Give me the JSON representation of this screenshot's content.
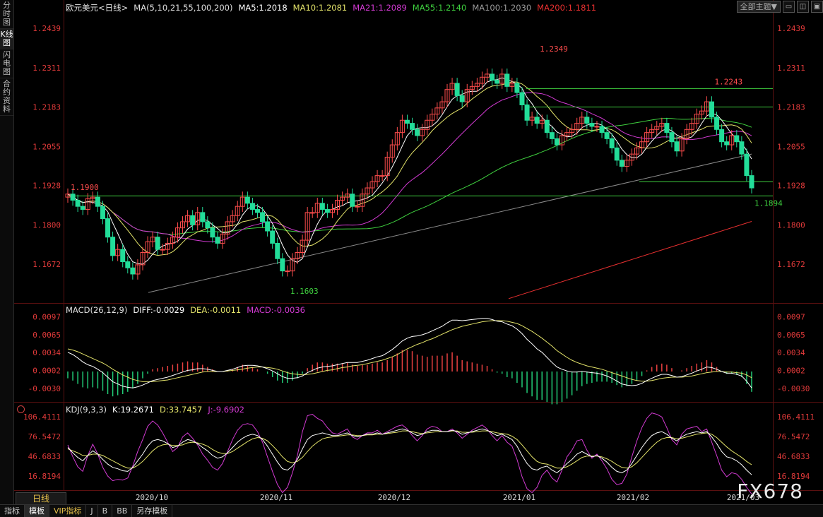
{
  "sidebar": [
    "分时图",
    "K线图",
    "闪电图",
    "合约资料"
  ],
  "topbar": {
    "theme_label": "全部主题▼",
    "buttons": [
      "▭",
      "◫",
      "▣"
    ]
  },
  "main_legend": [
    {
      "text": "欧元美元<日线>",
      "color": "#e0e0e0"
    },
    {
      "text": "MA(5,10,21,55,100,200)",
      "color": "#e0e0e0"
    },
    {
      "text": "MA5:1.2018",
      "color": "#ffffff"
    },
    {
      "text": "MA10:1.2081",
      "color": "#e3e36a"
    },
    {
      "text": "MA21:1.2089",
      "color": "#d23ad2"
    },
    {
      "text": "MA55:1.2140",
      "color": "#3fd13f"
    },
    {
      "text": "MA100:1.2030",
      "color": "#9a9a9a"
    },
    {
      "text": "MA200:1.1811",
      "color": "#e83030"
    }
  ],
  "macd_legend": [
    {
      "text": "MACD(26,12,9)",
      "color": "#e0e0e0"
    },
    {
      "text": "DIFF:-0.0029",
      "color": "#ffffff"
    },
    {
      "text": "DEA:-0.0011",
      "color": "#e3e36a"
    },
    {
      "text": "MACD:-0.0036",
      "color": "#d23ad2"
    }
  ],
  "kdj_legend": [
    {
      "text": "KDJ(9,3,3)",
      "color": "#e0e0e0"
    },
    {
      "text": "K:19.2671",
      "color": "#ffffff"
    },
    {
      "text": "D:33.7457",
      "color": "#e3e36a"
    },
    {
      "text": "J:-9.6902",
      "color": "#d23ad2"
    }
  ],
  "price_ticks": [
    "1.2439",
    "1.2311",
    "1.2183",
    "1.2055",
    "1.1928",
    "1.1800",
    "1.1672"
  ],
  "macd_ticks": [
    "0.0097",
    "0.0065",
    "0.0034",
    "0.0002",
    "-0.0030"
  ],
  "kdj_ticks": [
    "106.4111",
    "76.5472",
    "46.6833",
    "16.8194"
  ],
  "date_labels": [
    "2020/10",
    "2020/11",
    "2020/12",
    "2021/01",
    "2021/02",
    "2021/03"
  ],
  "annotations": [
    {
      "text": "1.1900",
      "color": "#ff4d4d"
    },
    {
      "text": "1.1603",
      "color": "#3fd13f"
    },
    {
      "text": "1.2349",
      "color": "#ff4d4d"
    },
    {
      "text": "1.2243",
      "color": "#ff4d4d"
    },
    {
      "text": "1.1894",
      "color": "#3fd13f"
    }
  ],
  "period": "日线",
  "bottom_tabs": [
    "指标",
    "模板",
    "VIP指标",
    "J",
    "B",
    "BB",
    "另存模板"
  ],
  "watermark": "FX678",
  "chart_data": {
    "type": "candlestick",
    "symbol": "欧元美元",
    "ylim": [
      1.1555,
      1.2485
    ],
    "closes": [
      1.19,
      1.188,
      1.186,
      1.185,
      1.1885,
      1.189,
      1.186,
      1.182,
      1.176,
      1.17,
      1.172,
      1.168,
      1.166,
      1.164,
      1.167,
      1.171,
      1.1745,
      1.176,
      1.172,
      1.172,
      1.174,
      1.176,
      1.179,
      1.181,
      1.183,
      1.18,
      1.184,
      1.181,
      1.179,
      1.176,
      1.174,
      1.177,
      1.181,
      1.183,
      1.186,
      1.189,
      1.187,
      1.185,
      1.184,
      1.181,
      1.178,
      1.174,
      1.169,
      1.165,
      1.165,
      1.169,
      1.171,
      1.175,
      1.184,
      1.184,
      1.187,
      1.185,
      1.184,
      1.185,
      1.188,
      1.189,
      1.19,
      1.186,
      1.186,
      1.19,
      1.192,
      1.194,
      1.196,
      1.196,
      1.202,
      1.206,
      1.21,
      1.214,
      1.213,
      1.211,
      1.209,
      1.211,
      1.214,
      1.216,
      1.218,
      1.22,
      1.224,
      1.226,
      1.222,
      1.22,
      1.224,
      1.225,
      1.226,
      1.228,
      1.229,
      1.227,
      1.226,
      1.229,
      1.225,
      1.226,
      1.223,
      1.219,
      1.214,
      1.215,
      1.213,
      1.214,
      1.21,
      1.208,
      1.206,
      1.209,
      1.21,
      1.211,
      1.213,
      1.215,
      1.213,
      1.212,
      1.212,
      1.21,
      1.208,
      1.205,
      1.201,
      1.199,
      1.201,
      1.203,
      1.205,
      1.207,
      1.21,
      1.211,
      1.212,
      1.213,
      1.21,
      1.207,
      1.204,
      1.208,
      1.211,
      1.213,
      1.216,
      1.217,
      1.22,
      1.215,
      1.211,
      1.207,
      1.206,
      1.209,
      1.207,
      1.203,
      1.196,
      1.192
    ],
    "macd_dif": [
      0.0034,
      0.003,
      0.0024,
      0.0017,
      0.0012,
      0.0009,
      0.0004,
      -0.0002,
      -0.001,
      -0.0018,
      -0.0022,
      -0.0026,
      -0.0028,
      -0.0029,
      -0.0027,
      -0.0024,
      -0.002,
      -0.0016,
      -0.0014,
      -0.0012,
      -0.001,
      -0.0007,
      -0.0004,
      -0.0001,
      0.0002,
      0.0003,
      0.0005,
      0.0005,
      0.0004,
      0.0002,
      0.0,
      0.0,
      0.0002,
      0.0004,
      0.0007,
      0.001,
      0.0011,
      0.0011,
      0.001,
      0.0008,
      0.0005,
      0.0001,
      -0.0004,
      -0.0009,
      -0.0012,
      -0.0012,
      -0.0011,
      -0.0008,
      -0.0002,
      0.0002,
      0.0006,
      0.0008,
      0.0009,
      0.001,
      0.0012,
      0.0014,
      0.0016,
      0.0016,
      0.0016,
      0.0018,
      0.002,
      0.0023,
      0.0026,
      0.0028,
      0.0033,
      0.0039,
      0.0046,
      0.0054,
      0.0059,
      0.0062,
      0.0063,
      0.0065,
      0.0068,
      0.0072,
      0.0076,
      0.008,
      0.0086,
      0.0091,
      0.0091,
      0.009,
      0.0091,
      0.0092,
      0.0093,
      0.0094,
      0.0094,
      0.0092,
      0.0089,
      0.0088,
      0.0084,
      0.0081,
      0.0075,
      0.0067,
      0.0057,
      0.0049,
      0.004,
      0.0034,
      0.0025,
      0.0016,
      0.0008,
      0.0004,
      0.0001,
      -0.0001,
      -0.0001,
      0.0,
      -0.0001,
      -0.0002,
      -0.0003,
      -0.0005,
      -0.0008,
      -0.0012,
      -0.0017,
      -0.0022,
      -0.0024,
      -0.0025,
      -0.0024,
      -0.0021,
      -0.0016,
      -0.0012,
      -0.0008,
      -0.0005,
      -0.0005,
      -0.0007,
      -0.001,
      -0.0009,
      -0.0006,
      -0.0003,
      0.0001,
      0.0004,
      0.0008,
      0.0007,
      0.0004,
      0.0,
      -0.0003,
      -0.0003,
      -0.0005,
      -0.0008,
      -0.0017,
      -0.0029
    ],
    "macd_dea": [
      0.004,
      0.0038,
      0.0035,
      0.0031,
      0.0027,
      0.0023,
      0.0019,
      0.0015,
      0.001,
      0.0004,
      -0.0001,
      -0.0006,
      -0.001,
      -0.0014,
      -0.0016,
      -0.0018,
      -0.0018,
      -0.0018,
      -0.0017,
      -0.0016,
      -0.0015,
      -0.0013,
      -0.0011,
      -0.0009,
      -0.0007,
      -0.0005,
      -0.0003,
      -0.0001,
      0.0,
      0.0,
      0.0,
      0.0,
      0.0001,
      0.0002,
      0.0003,
      0.0004,
      0.0006,
      0.0007,
      0.0008,
      0.0008,
      0.0007,
      0.0006,
      0.0004,
      0.0001,
      -0.0002,
      -0.0004,
      -0.0005,
      -0.0006,
      -0.0005,
      -0.0004,
      -0.0002,
      0.0,
      0.0002,
      0.0003,
      0.0005,
      0.0007,
      0.0008,
      0.001,
      0.0011,
      0.0012,
      0.0014,
      0.0016,
      0.0018,
      0.002,
      0.0023,
      0.0026,
      0.003,
      0.0035,
      0.004,
      0.0044,
      0.0048,
      0.0051,
      0.0055,
      0.0058,
      0.0062,
      0.0066,
      0.007,
      0.0074,
      0.0077,
      0.008,
      0.0082,
      0.0084,
      0.0086,
      0.0088,
      0.0089,
      0.009,
      0.009,
      0.009,
      0.0089,
      0.0087,
      0.0085,
      0.0081,
      0.0076,
      0.0071,
      0.0065,
      0.0059,
      0.0052,
      0.0045,
      0.0037,
      0.0031,
      0.0025,
      0.002,
      0.0016,
      0.0013,
      0.001,
      0.0008,
      0.0006,
      0.0004,
      0.0001,
      -0.0002,
      -0.0005,
      -0.0008,
      -0.0011,
      -0.0014,
      -0.0016,
      -0.0017,
      -0.0017,
      -0.0016,
      -0.0014,
      -0.0012,
      -0.0011,
      -0.001,
      -0.001,
      -0.001,
      -0.0009,
      -0.0008,
      -0.0006,
      -0.0004,
      -0.0002,
      -0.0001,
      0.0,
      0.0,
      -0.0001,
      -0.0001,
      -0.0002,
      -0.0003,
      -0.0006,
      -0.0011
    ],
    "kdj_k": [
      60,
      52,
      45,
      40,
      48,
      55,
      50,
      42,
      35,
      30,
      28,
      25,
      24,
      30,
      40,
      50,
      62,
      70,
      72,
      70,
      66,
      60,
      62,
      68,
      72,
      70,
      66,
      60,
      55,
      48,
      44,
      46,
      52,
      60,
      68,
      74,
      78,
      80,
      78,
      72,
      62,
      50,
      38,
      28,
      26,
      32,
      42,
      58,
      72,
      78,
      80,
      82,
      80,
      78,
      78,
      80,
      82,
      78,
      76,
      78,
      80,
      80,
      82,
      80,
      82,
      84,
      86,
      88,
      86,
      82,
      78,
      80,
      84,
      86,
      86,
      84,
      84,
      86,
      84,
      80,
      82,
      84,
      86,
      88,
      86,
      82,
      78,
      80,
      76,
      72,
      62,
      48,
      36,
      28,
      26,
      30,
      32,
      26,
      22,
      28,
      36,
      42,
      50,
      54,
      50,
      46,
      48,
      44,
      38,
      30,
      24,
      22,
      26,
      36,
      48,
      60,
      70,
      78,
      82,
      84,
      80,
      74,
      70,
      76,
      80,
      82,
      84,
      82,
      84,
      76,
      66,
      54,
      46,
      44,
      40,
      34,
      26,
      19
    ],
    "kdj_d": [
      58,
      55,
      52,
      48,
      48,
      50,
      50,
      48,
      44,
      40,
      36,
      32,
      29,
      29,
      33,
      39,
      47,
      55,
      61,
      64,
      65,
      63,
      63,
      64,
      67,
      68,
      67,
      65,
      62,
      57,
      53,
      51,
      51,
      54,
      59,
      64,
      69,
      73,
      75,
      74,
      70,
      63,
      55,
      46,
      39,
      37,
      39,
      45,
      54,
      62,
      68,
      73,
      75,
      76,
      77,
      78,
      79,
      79,
      78,
      78,
      79,
      79,
      80,
      80,
      81,
      82,
      83,
      85,
      85,
      84,
      82,
      81,
      82,
      83,
      84,
      84,
      84,
      85,
      85,
      83,
      83,
      83,
      84,
      85,
      85,
      84,
      82,
      81,
      80,
      77,
      72,
      64,
      55,
      46,
      39,
      36,
      35,
      32,
      29,
      29,
      31,
      35,
      40,
      45,
      47,
      47,
      47,
      46,
      43,
      39,
      34,
      30,
      29,
      31,
      37,
      45,
      53,
      61,
      68,
      73,
      75,
      75,
      73,
      74,
      76,
      78,
      80,
      81,
      82,
      80,
      75,
      68,
      61,
      55,
      50,
      45,
      39,
      34
    ],
    "kdj_j": [
      64,
      46,
      31,
      24,
      48,
      65,
      50,
      30,
      17,
      10,
      12,
      11,
      14,
      32,
      54,
      72,
      92,
      100,
      94,
      82,
      68,
      54,
      60,
      76,
      82,
      74,
      64,
      50,
      41,
      30,
      26,
      36,
      54,
      72,
      86,
      94,
      96,
      94,
      84,
      68,
      46,
      24,
      4,
      -8,
      0,
      22,
      48,
      84,
      108,
      110,
      104,
      100,
      90,
      82,
      80,
      84,
      88,
      76,
      72,
      78,
      82,
      82,
      86,
      80,
      84,
      88,
      92,
      94,
      88,
      78,
      70,
      78,
      88,
      92,
      90,
      84,
      84,
      88,
      82,
      74,
      80,
      86,
      90,
      94,
      88,
      78,
      70,
      78,
      68,
      62,
      42,
      16,
      -2,
      -8,
      0,
      18,
      26,
      14,
      8,
      26,
      46,
      56,
      70,
      72,
      56,
      44,
      50,
      40,
      28,
      12,
      4,
      6,
      20,
      46,
      70,
      90,
      104,
      112,
      110,
      106,
      90,
      72,
      64,
      80,
      88,
      90,
      92,
      84,
      88,
      68,
      48,
      26,
      16,
      22,
      20,
      12,
      0,
      -10
    ]
  }
}
